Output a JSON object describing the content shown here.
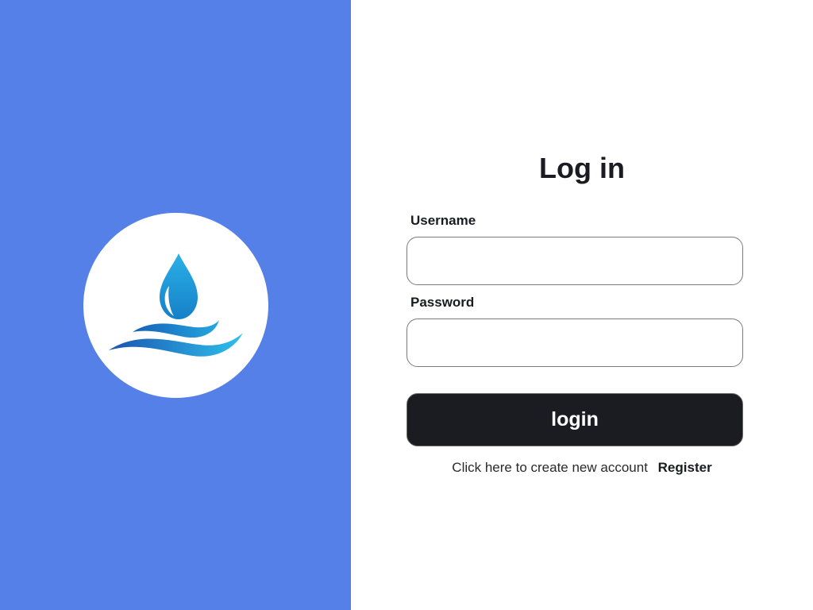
{
  "branding": {
    "logo_icon": "water-drop-waves-icon",
    "panel_color": "#5580e8",
    "drop_color": "#1e9ad8",
    "wave_color": "#1a6fc2"
  },
  "login_form": {
    "title": "Log in",
    "username_label": "Username",
    "username_value": "",
    "username_placeholder": "",
    "password_label": "Password",
    "password_value": "",
    "password_placeholder": "",
    "submit_label": "login",
    "submit_color": "#1b1c22"
  },
  "register": {
    "prompt": "Click here to create new account",
    "link_label": "Register"
  }
}
